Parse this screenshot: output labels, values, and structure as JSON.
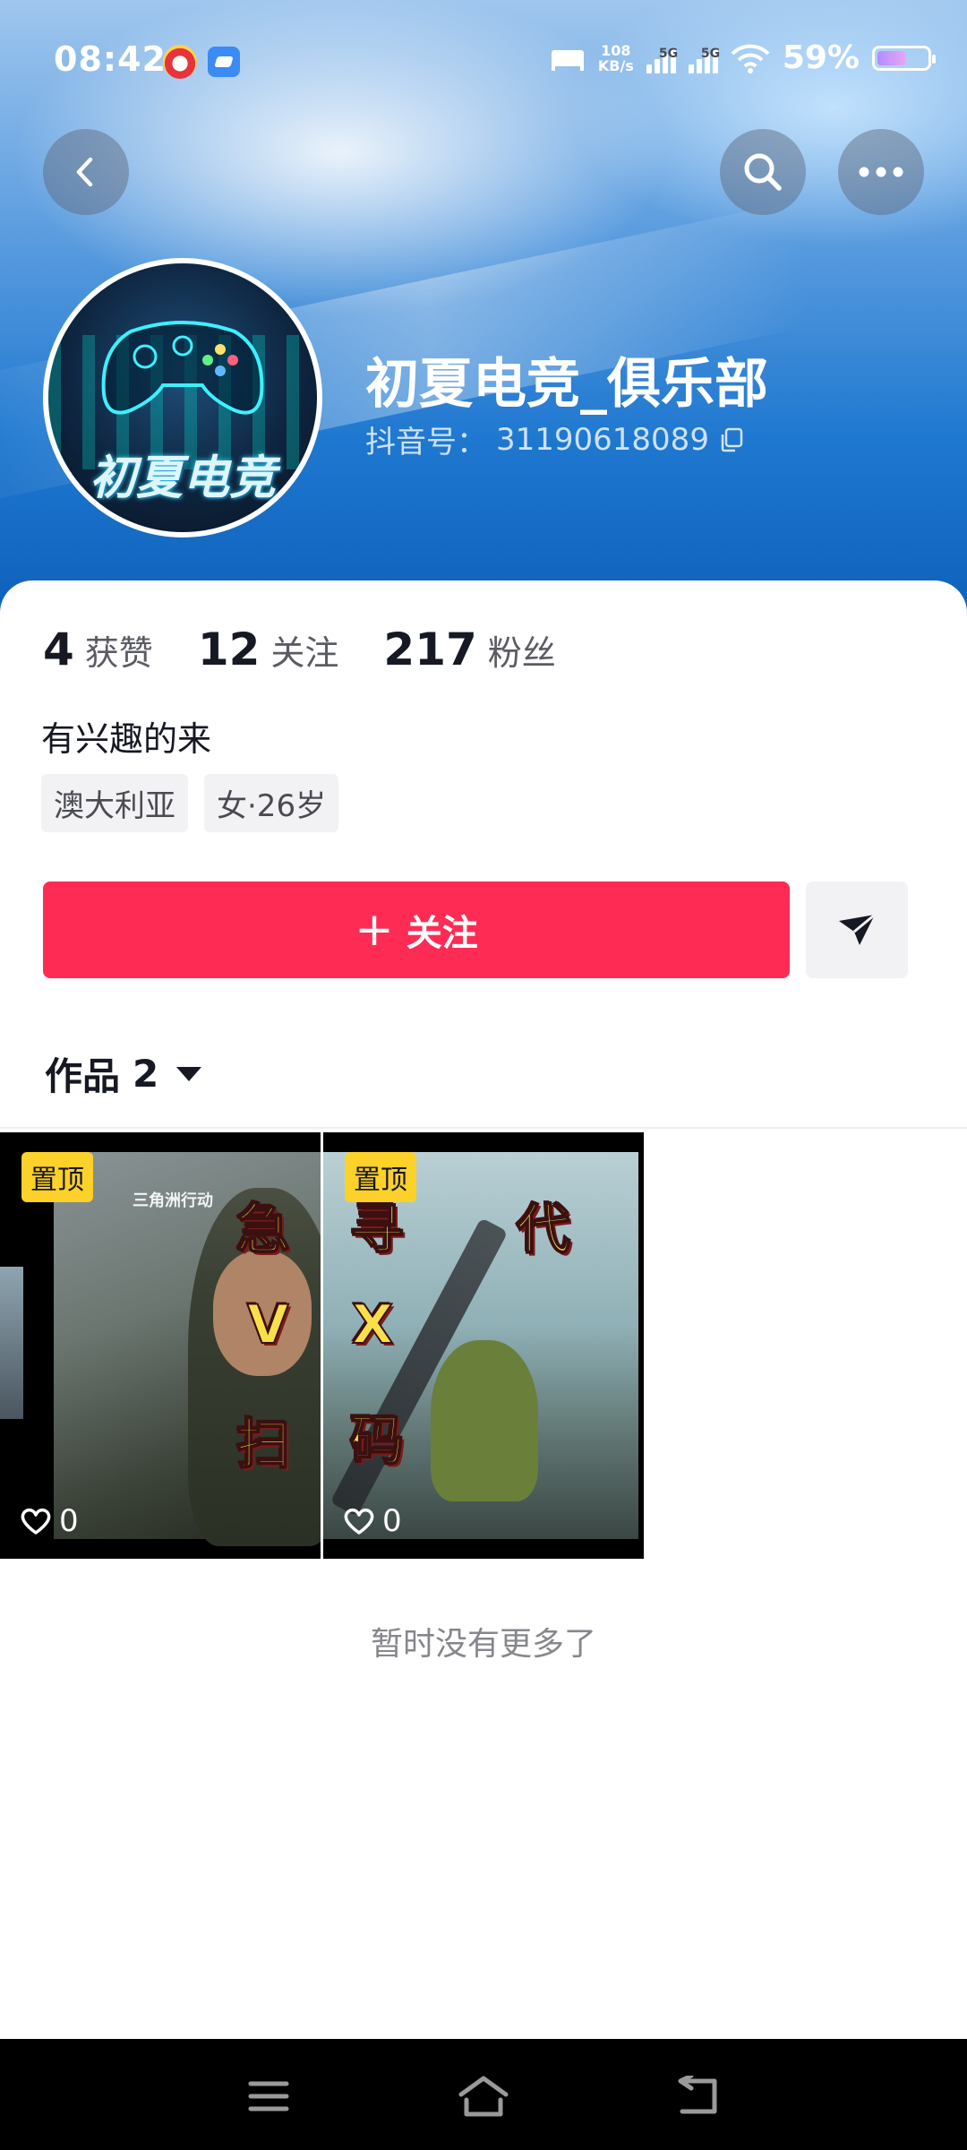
{
  "status_bar": {
    "time": "08:42",
    "net_speed_value": "108",
    "net_speed_unit": "KB/s",
    "signal1_label": "5G",
    "signal2_label": "5G",
    "battery_percent": "59%",
    "battery_level": 0.59
  },
  "profile": {
    "display_name": "初夏电竞_俱乐部",
    "douyin_id_label": "抖音号：",
    "douyin_id": "31190618089",
    "avatar_text": "初夏电竞",
    "bio": "有兴趣的来",
    "tags": [
      "澳大利亚",
      "女·26岁"
    ]
  },
  "stats": {
    "likes_count": "4",
    "likes_label": "获赞",
    "following_count": "12",
    "following_label": "关注",
    "followers_count": "217",
    "followers_label": "粉丝"
  },
  "actions": {
    "follow_label": "关注",
    "follow_plus": "+"
  },
  "works": {
    "tab_label": "作品",
    "count": "2",
    "items": [
      {
        "pin_label": "置顶",
        "overlay_chars": [
          "急",
          "V",
          "扫"
        ],
        "logo_text": "三角洲行动",
        "likes": "0"
      },
      {
        "pin_label": "置顶",
        "overlay_chars": [
          "寻",
          "代",
          "X",
          "码"
        ],
        "likes": "0"
      }
    ],
    "no_more_text": "暂时没有更多了"
  },
  "colors": {
    "accent": "#fe2c55",
    "pin_badge": "#fcd12a",
    "banner_blue": "#1f78d0"
  },
  "icons": {
    "back": "back-arrow-icon",
    "search": "search-icon",
    "more": "more-dots-icon",
    "copy": "copy-icon",
    "share": "send-icon",
    "like": "heart-icon",
    "nav_menu": "menu-icon",
    "nav_home": "home-icon",
    "nav_back": "back-icon"
  }
}
